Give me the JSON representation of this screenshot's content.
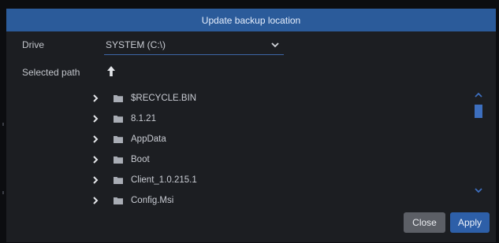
{
  "dialog": {
    "title": "Update backup location"
  },
  "drive": {
    "label": "Drive",
    "selected": "SYSTEM (C:\\)"
  },
  "path": {
    "label": "Selected path",
    "up_icon": "arrow-up-icon"
  },
  "folders": [
    {
      "name": "$RECYCLE.BIN"
    },
    {
      "name": "8.1.21"
    },
    {
      "name": "AppData"
    },
    {
      "name": "Boot"
    },
    {
      "name": "Client_1.0.215.1"
    },
    {
      "name": "Config.Msi"
    }
  ],
  "buttons": {
    "close": "Close",
    "apply": "Apply"
  },
  "colors": {
    "titlebar": "#2b5b9a",
    "dialog_bg": "#1c1e22",
    "accent": "#3d6fbf",
    "close_bg": "#5c5f66",
    "apply_bg": "#2d5fa8"
  }
}
